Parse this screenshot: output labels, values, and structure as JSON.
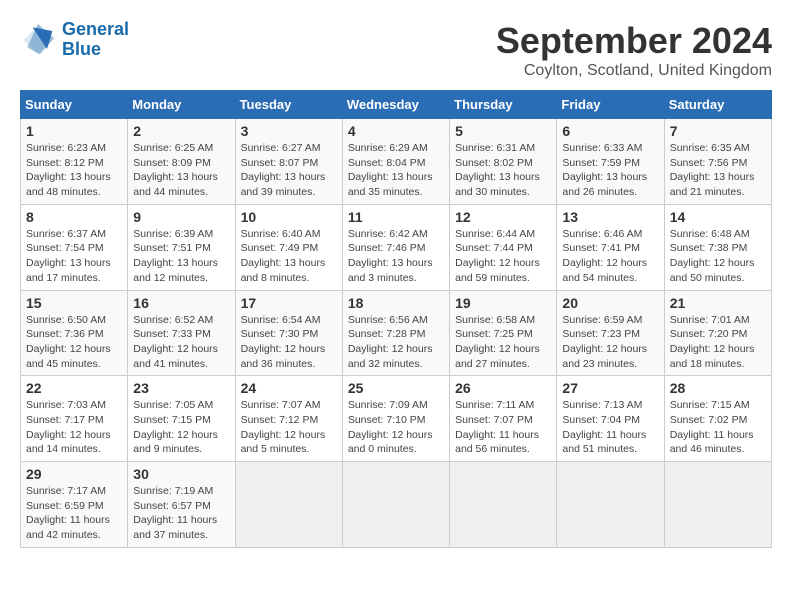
{
  "header": {
    "logo_line1": "General",
    "logo_line2": "Blue",
    "title": "September 2024",
    "subtitle": "Coylton, Scotland, United Kingdom"
  },
  "days_of_week": [
    "Sunday",
    "Monday",
    "Tuesday",
    "Wednesday",
    "Thursday",
    "Friday",
    "Saturday"
  ],
  "weeks": [
    [
      {
        "day": "1",
        "sunrise": "6:23 AM",
        "sunset": "8:12 PM",
        "daylight": "13 hours and 48 minutes."
      },
      {
        "day": "2",
        "sunrise": "6:25 AM",
        "sunset": "8:09 PM",
        "daylight": "13 hours and 44 minutes."
      },
      {
        "day": "3",
        "sunrise": "6:27 AM",
        "sunset": "8:07 PM",
        "daylight": "13 hours and 39 minutes."
      },
      {
        "day": "4",
        "sunrise": "6:29 AM",
        "sunset": "8:04 PM",
        "daylight": "13 hours and 35 minutes."
      },
      {
        "day": "5",
        "sunrise": "6:31 AM",
        "sunset": "8:02 PM",
        "daylight": "13 hours and 30 minutes."
      },
      {
        "day": "6",
        "sunrise": "6:33 AM",
        "sunset": "7:59 PM",
        "daylight": "13 hours and 26 minutes."
      },
      {
        "day": "7",
        "sunrise": "6:35 AM",
        "sunset": "7:56 PM",
        "daylight": "13 hours and 21 minutes."
      }
    ],
    [
      {
        "day": "8",
        "sunrise": "6:37 AM",
        "sunset": "7:54 PM",
        "daylight": "13 hours and 17 minutes."
      },
      {
        "day": "9",
        "sunrise": "6:39 AM",
        "sunset": "7:51 PM",
        "daylight": "13 hours and 12 minutes."
      },
      {
        "day": "10",
        "sunrise": "6:40 AM",
        "sunset": "7:49 PM",
        "daylight": "13 hours and 8 minutes."
      },
      {
        "day": "11",
        "sunrise": "6:42 AM",
        "sunset": "7:46 PM",
        "daylight": "13 hours and 3 minutes."
      },
      {
        "day": "12",
        "sunrise": "6:44 AM",
        "sunset": "7:44 PM",
        "daylight": "12 hours and 59 minutes."
      },
      {
        "day": "13",
        "sunrise": "6:46 AM",
        "sunset": "7:41 PM",
        "daylight": "12 hours and 54 minutes."
      },
      {
        "day": "14",
        "sunrise": "6:48 AM",
        "sunset": "7:38 PM",
        "daylight": "12 hours and 50 minutes."
      }
    ],
    [
      {
        "day": "15",
        "sunrise": "6:50 AM",
        "sunset": "7:36 PM",
        "daylight": "12 hours and 45 minutes."
      },
      {
        "day": "16",
        "sunrise": "6:52 AM",
        "sunset": "7:33 PM",
        "daylight": "12 hours and 41 minutes."
      },
      {
        "day": "17",
        "sunrise": "6:54 AM",
        "sunset": "7:30 PM",
        "daylight": "12 hours and 36 minutes."
      },
      {
        "day": "18",
        "sunrise": "6:56 AM",
        "sunset": "7:28 PM",
        "daylight": "12 hours and 32 minutes."
      },
      {
        "day": "19",
        "sunrise": "6:58 AM",
        "sunset": "7:25 PM",
        "daylight": "12 hours and 27 minutes."
      },
      {
        "day": "20",
        "sunrise": "6:59 AM",
        "sunset": "7:23 PM",
        "daylight": "12 hours and 23 minutes."
      },
      {
        "day": "21",
        "sunrise": "7:01 AM",
        "sunset": "7:20 PM",
        "daylight": "12 hours and 18 minutes."
      }
    ],
    [
      {
        "day": "22",
        "sunrise": "7:03 AM",
        "sunset": "7:17 PM",
        "daylight": "12 hours and 14 minutes."
      },
      {
        "day": "23",
        "sunrise": "7:05 AM",
        "sunset": "7:15 PM",
        "daylight": "12 hours and 9 minutes."
      },
      {
        "day": "24",
        "sunrise": "7:07 AM",
        "sunset": "7:12 PM",
        "daylight": "12 hours and 5 minutes."
      },
      {
        "day": "25",
        "sunrise": "7:09 AM",
        "sunset": "7:10 PM",
        "daylight": "12 hours and 0 minutes."
      },
      {
        "day": "26",
        "sunrise": "7:11 AM",
        "sunset": "7:07 PM",
        "daylight": "11 hours and 56 minutes."
      },
      {
        "day": "27",
        "sunrise": "7:13 AM",
        "sunset": "7:04 PM",
        "daylight": "11 hours and 51 minutes."
      },
      {
        "day": "28",
        "sunrise": "7:15 AM",
        "sunset": "7:02 PM",
        "daylight": "11 hours and 46 minutes."
      }
    ],
    [
      {
        "day": "29",
        "sunrise": "7:17 AM",
        "sunset": "6:59 PM",
        "daylight": "11 hours and 42 minutes."
      },
      {
        "day": "30",
        "sunrise": "7:19 AM",
        "sunset": "6:57 PM",
        "daylight": "11 hours and 37 minutes."
      },
      null,
      null,
      null,
      null,
      null
    ]
  ]
}
